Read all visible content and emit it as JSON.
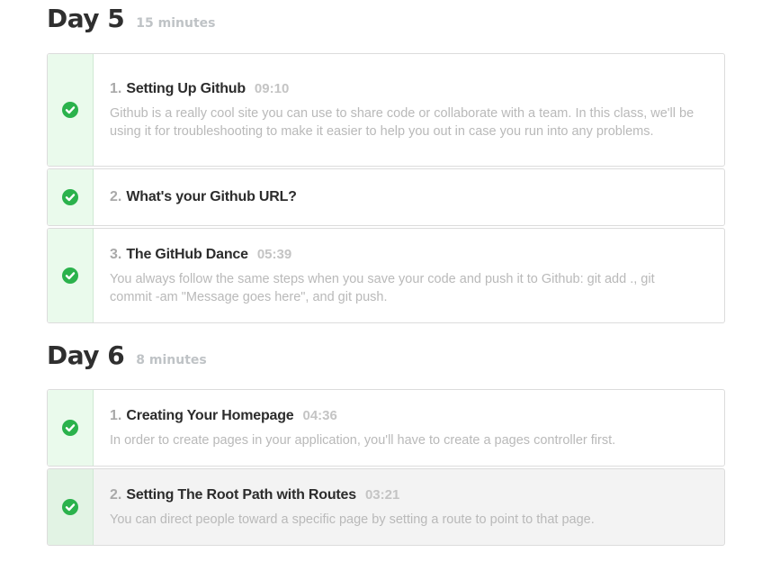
{
  "days": [
    {
      "title": "Day 5",
      "duration": "15 minutes",
      "lessons": [
        {
          "number": "1.",
          "title": "Setting Up Github",
          "time": "09:10",
          "description": "Github is a really cool site you can use to share code or collaborate with a team. In this class, we'll be using it for troubleshooting to make it easier to help you out in case you run into any problems.",
          "completed": true
        },
        {
          "number": "2.",
          "title": "What's your Github URL?",
          "time": "",
          "description": "",
          "completed": true
        },
        {
          "number": "3.",
          "title": "The GitHub Dance",
          "time": "05:39",
          "description": "You always follow the same steps when you save your code and push it to Github: git add ., git commit -am \"Message goes here\", and git push.",
          "completed": true
        }
      ]
    },
    {
      "title": "Day 6",
      "duration": "8 minutes",
      "lessons": [
        {
          "number": "1.",
          "title": "Creating Your Homepage",
          "time": "04:36",
          "description": "In order to create pages in your application, you'll have to create a pages controller first.",
          "completed": true
        },
        {
          "number": "2.",
          "title": "Setting The Root Path with Routes",
          "time": "03:21",
          "description": "You can direct people toward a specific page by setting a route to point to that page.",
          "completed": true
        }
      ]
    }
  ],
  "colors": {
    "check_green": "#2bb24c",
    "check_column_bg": "#eafaec",
    "active_row_bg": "#f3f3f3"
  },
  "icons": {
    "completed": "check-circle-icon"
  }
}
